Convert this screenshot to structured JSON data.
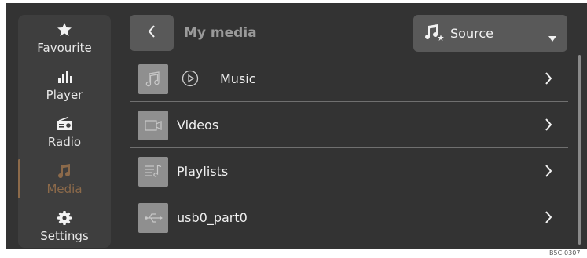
{
  "sidebar": {
    "items": [
      {
        "label": "Favourite",
        "icon": "star-icon"
      },
      {
        "label": "Player",
        "icon": "equalizer-icon"
      },
      {
        "label": "Radio",
        "icon": "radio-icon"
      },
      {
        "label": "Media",
        "icon": "music-note-icon",
        "active": true
      },
      {
        "label": "Settings",
        "icon": "gear-icon"
      }
    ],
    "active_color": "#8c6a4a"
  },
  "header": {
    "title": "My media",
    "source_label": "Source"
  },
  "list": {
    "items": [
      {
        "label": "Music"
      },
      {
        "label": "Videos"
      },
      {
        "label": "Playlists"
      },
      {
        "label": "usb0_part0"
      }
    ]
  },
  "footer": {
    "tag": "B5C-0307"
  }
}
